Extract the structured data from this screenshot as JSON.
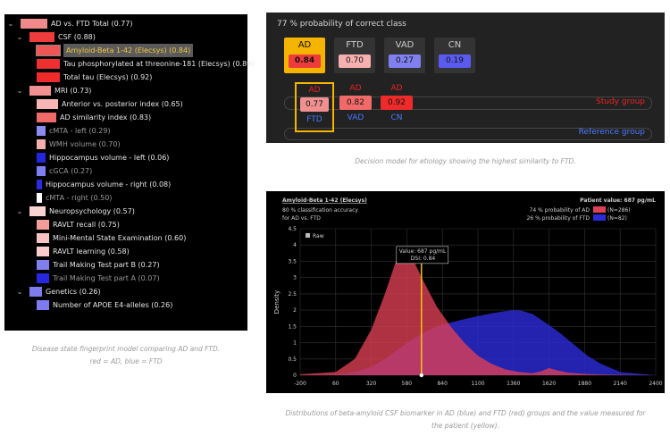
{
  "tree": {
    "rows": [
      {
        "label": "AD vs. FTD Total (0.77)",
        "level": 0,
        "chevron": true,
        "color": "#f08a8a",
        "bar": 30,
        "dim": false,
        "selected": false
      },
      {
        "label": "CSF (0.88)",
        "level": 1,
        "chevron": true,
        "color": "#ee3b3b",
        "bar": 28,
        "dim": false,
        "selected": false
      },
      {
        "label": "Amyloid-Beta 1-42 (Elecsys) (0.84)",
        "level": 2,
        "chevron": false,
        "color": "#f05555",
        "bar": 26,
        "dim": false,
        "selected": true
      },
      {
        "label": "Tau phosphorylated at threonine-181 (Elecsys) (0.89)",
        "level": 2,
        "chevron": false,
        "color": "#ee3030",
        "bar": 26,
        "dim": false,
        "selected": false
      },
      {
        "label": "Total tau (Elecsys) (0.92)",
        "level": 2,
        "chevron": false,
        "color": "#ee2a2a",
        "bar": 26,
        "dim": false,
        "selected": false
      },
      {
        "label": "MRI (0.73)",
        "level": 1,
        "chevron": true,
        "color": "#f09090",
        "bar": 24,
        "dim": false,
        "selected": false
      },
      {
        "label": "Anterior vs. posterior index (0.65)",
        "level": 2,
        "chevron": false,
        "color": "#f7b5b5",
        "bar": 24,
        "dim": false,
        "selected": false
      },
      {
        "label": "AD similarity index (0.83)",
        "level": 2,
        "chevron": false,
        "color": "#f06a6a",
        "bar": 22,
        "dim": false,
        "selected": false
      },
      {
        "label": "cMTA - left (0.29)",
        "level": 2,
        "chevron": false,
        "color": "#8b8bf2",
        "bar": 10,
        "dim": true,
        "selected": false
      },
      {
        "label": "WMH volume (0.70)",
        "level": 2,
        "chevron": false,
        "color": "#f4b0b0",
        "bar": 10,
        "dim": true,
        "selected": false
      },
      {
        "label": "Hippocampus volume - left (0.06)",
        "level": 2,
        "chevron": false,
        "color": "#2525e0",
        "bar": 10,
        "dim": false,
        "selected": false
      },
      {
        "label": "cGCA (0.27)",
        "level": 2,
        "chevron": false,
        "color": "#7f7ff0",
        "bar": 10,
        "dim": true,
        "selected": false
      },
      {
        "label": "Hippocampus volume - right (0.08)",
        "level": 2,
        "chevron": false,
        "color": "#2a2ae2",
        "bar": 6,
        "dim": false,
        "selected": false
      },
      {
        "label": "cMTA - right (0.50)",
        "level": 2,
        "chevron": false,
        "color": "#ffffff",
        "bar": 6,
        "dim": true,
        "selected": false
      },
      {
        "label": "Neuropsychology (0.57)",
        "level": 1,
        "chevron": true,
        "color": "#f9d2d2",
        "bar": 18,
        "dim": false,
        "selected": false
      },
      {
        "label": "RAVLT recall (0.75)",
        "level": 2,
        "chevron": false,
        "color": "#f39c9c",
        "bar": 14,
        "dim": false,
        "selected": false
      },
      {
        "label": "Mini-Mental State Examination (0.60)",
        "level": 2,
        "chevron": false,
        "color": "#f7c2c2",
        "bar": 14,
        "dim": false,
        "selected": false
      },
      {
        "label": "RAVLT learning (0.58)",
        "level": 2,
        "chevron": false,
        "color": "#f8cccc",
        "bar": 14,
        "dim": false,
        "selected": false
      },
      {
        "label": "Trail Making Test part B (0.27)",
        "level": 2,
        "chevron": false,
        "color": "#7f7ff0",
        "bar": 14,
        "dim": false,
        "selected": false
      },
      {
        "label": "Trail Making Test part A (0.07)",
        "level": 2,
        "chevron": false,
        "color": "#2727e0",
        "bar": 14,
        "dim": true,
        "selected": false
      },
      {
        "label": "Genetics (0.26)",
        "level": 1,
        "chevron": true,
        "color": "#7c7cf0",
        "bar": 14,
        "dim": false,
        "selected": false
      },
      {
        "label": "Number of APOE E4-alleles (0.26)",
        "level": 2,
        "chevron": false,
        "color": "#7c7cf0",
        "bar": 14,
        "dim": false,
        "selected": false
      }
    ],
    "caption_line1": "Disease state fingerprint model comparing AD and FTD.",
    "caption_line2": "red = AD, blue = FTD"
  },
  "decision": {
    "title": "77 % probability of correct class",
    "tiles": [
      {
        "label": "AD",
        "value": "0.84",
        "color": "#ee3b3b",
        "active": true
      },
      {
        "label": "FTD",
        "value": "0.70",
        "color": "#f7b0b0",
        "active": false
      },
      {
        "label": "VAD",
        "value": "0.27",
        "color": "#8080f0",
        "active": false
      },
      {
        "label": "CN",
        "value": "0.19",
        "color": "#5a5af0",
        "active": false
      }
    ],
    "study_group": "Study group",
    "reference_group": "Reference group",
    "comparisons": [
      {
        "top": "AD",
        "value": "0.77",
        "bottom": "FTD",
        "color": "#f09090",
        "boxed": true
      },
      {
        "top": "AD",
        "value": "0.82",
        "bottom": "VAD",
        "color": "#f06a6a",
        "boxed": false
      },
      {
        "top": "AD",
        "value": "0.92",
        "bottom": "CN",
        "color": "#ee2a2a",
        "boxed": false
      }
    ],
    "caption": "Decision model for etiology showing the highest similarity to FTD."
  },
  "distribution": {
    "title": "Amyloid-Beta 1-42 (Elecsys)",
    "patient_value": "Patient value: 687 pg/mL",
    "accuracy_line1": "80 % classification accuracy",
    "accuracy_line2": "for AD vs. FTD",
    "legend_ad": "74 % probability of AD",
    "legend_ad_n": "(N=286)",
    "legend_ftd": "26 % probability of FTD",
    "legend_ftd_n": "(N=82)",
    "raw_label": "Raw",
    "ylabel": "Density",
    "tooltip_line1": "Value: 687 pg/mL",
    "tooltip_line2": "DSI: 0.84",
    "caption_line1": "Distributions of beta-amyloid CSF biomarker in AD (blue) and FTD (red) groups and the value measured for",
    "caption_line2": "the patient (yellow)."
  },
  "chart_data": {
    "type": "area",
    "title": "Amyloid-Beta 1-42 (Elecsys)",
    "xlabel": "",
    "ylabel": "Density",
    "xlim": [
      -200,
      2400
    ],
    "ylim": [
      0,
      4.5
    ],
    "x_ticks": [
      "-200",
      "60",
      "320",
      "580",
      "840",
      "1100",
      "1360",
      "1620",
      "1880",
      "2140",
      "2400"
    ],
    "y_ticks": [
      "0",
      "0.5",
      "1",
      "1.5",
      "2",
      "2.5",
      "3",
      "3.5",
      "4",
      "4.5"
    ],
    "grid": true,
    "patient_value": 687,
    "series": [
      {
        "name": "AD",
        "color": "#e04055",
        "x": [
          -200,
          60,
          200,
          320,
          420,
          500,
          560,
          620,
          700,
          800,
          900,
          1000,
          1100,
          1200,
          1300,
          1400,
          1500,
          1560,
          1620,
          1680,
          1760,
          1880,
          2000,
          2140,
          2400
        ],
        "y": [
          0.03,
          0.1,
          0.5,
          1.4,
          2.5,
          3.5,
          3.9,
          3.6,
          2.9,
          2.1,
          1.5,
          1.0,
          0.6,
          0.35,
          0.18,
          0.1,
          0.06,
          0.12,
          0.22,
          0.15,
          0.08,
          0.04,
          0.02,
          0.01,
          0.0
        ]
      },
      {
        "name": "FTD",
        "color": "#2b2bd6",
        "x": [
          -200,
          60,
          200,
          320,
          420,
          500,
          600,
          700,
          800,
          900,
          1000,
          1100,
          1200,
          1300,
          1360,
          1420,
          1500,
          1600,
          1700,
          1800,
          1900,
          2000,
          2140,
          2400
        ],
        "y": [
          0.0,
          0.02,
          0.1,
          0.25,
          0.5,
          0.75,
          1.05,
          1.3,
          1.5,
          1.62,
          1.72,
          1.82,
          1.9,
          1.97,
          2.0,
          1.98,
          1.88,
          1.6,
          1.3,
          0.95,
          0.6,
          0.35,
          0.1,
          0.0
        ]
      }
    ]
  }
}
